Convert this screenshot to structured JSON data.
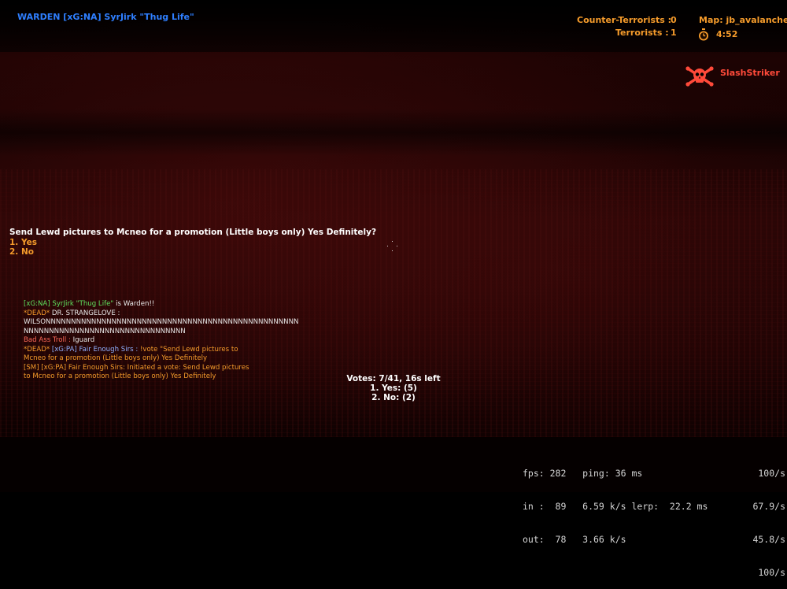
{
  "hud": {
    "warden": "WARDEN [xG:NA] SyrJirk \"Thug Life\"",
    "ct_label": "Counter-Terrorists :",
    "ct_count": "0",
    "t_label": "Terrorists :",
    "t_count": "1",
    "map": "Map: jb_avalanche",
    "timer": "4:52",
    "timer_icon": "stopwatch-icon",
    "killfeed": {
      "icon": "skull-crossbones-icon",
      "name": "SlashStriker"
    }
  },
  "vote_menu": {
    "question": "Send Lewd pictures to Mcneo for a promotion (Little boys only) Yes Definitely?",
    "options": [
      "1. Yes",
      "2. No"
    ]
  },
  "chat": [
    {
      "prefix": "[xG:NA] SyrJirk \"Thug Life\"",
      "text": " is Warden!!"
    },
    {
      "dead": "*DEAD*",
      "name": " DR. STRANGELOVE :"
    },
    {
      "text": "WILSONNNNNNNNNNNNNNNNNNNNNNNNNNNNNNNNNNNNNNNNNNNNNNNNNN"
    },
    {
      "text": "NNNNNNNNNNNNNNNNNNNNNNNNNNNNNNNN"
    },
    {
      "name": "Bad Ass Troll :",
      "text": "  Iguard"
    },
    {
      "dead": "*DEAD*",
      "name": " [xG:PA] Fair Enough Sirs :",
      "text": "  !vote \"Send Lewd pictures to"
    },
    {
      "text": "Mcneo for a promotion (Little boys only) Yes Definitely"
    },
    {
      "text": "[SM] [xG:PA] Fair Enough Sirs: Initiated a vote: Send Lewd pictures"
    },
    {
      "text": "to Mcneo for a promotion (Little boys only) Yes Definitely"
    }
  ],
  "vote_status": {
    "header": "Votes: 7/41, 16s left",
    "yes": "1. Yes: (5)",
    "no": "2. No: (2)"
  },
  "netgraph": {
    "line1": "fps: 282   ping: 36 ms",
    "line2": "in :  89   6.59 k/s lerp:  22.2 ms",
    "line3": "out:  78   3.66 k/s",
    "rates": [
      "100/s",
      "67.9/s",
      "45.8/s",
      "100/s"
    ]
  },
  "colors": {
    "warden_blue": "#2f7fff",
    "hud_orange": "#f59b2b",
    "killfeed_red": "#ff4a3a"
  }
}
